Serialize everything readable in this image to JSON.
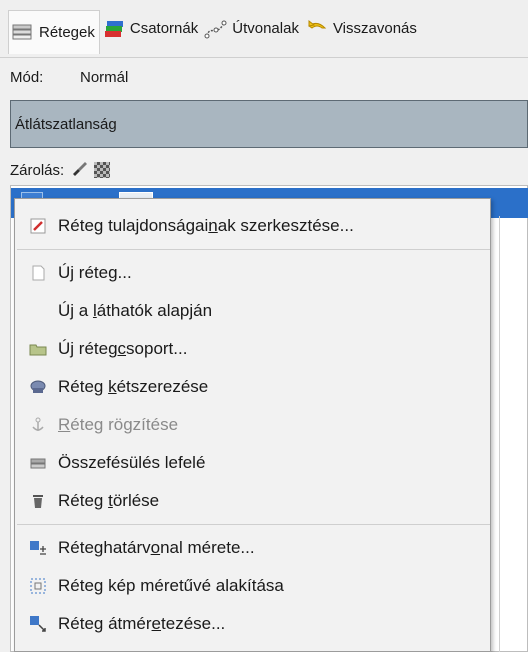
{
  "tabs": [
    {
      "label": "Rétegek",
      "icon": "layers-icon",
      "active": true
    },
    {
      "label": "Csatornák",
      "icon": "channels-icon",
      "active": false
    },
    {
      "label": "Útvonalak",
      "icon": "paths-icon",
      "active": false
    },
    {
      "label": "Visszavonás",
      "icon": "undo-history-icon",
      "active": false
    }
  ],
  "mode": {
    "label": "Mód:",
    "value": "Normál"
  },
  "opacity": {
    "label": "Átlátszatlanság"
  },
  "lock": {
    "label": "Zárolás:"
  },
  "menu": {
    "edit_attributes": {
      "before": "Réteg tulajdonságai",
      "key": "n",
      "after": "ak szerkesztése...",
      "icon": "edit-icon"
    },
    "new_layer": {
      "before": "Új réteg...",
      "icon": "new-layer-icon"
    },
    "new_from_visible": {
      "before": "Új a ",
      "key": "l",
      "after": "áthatók alapján"
    },
    "new_group": {
      "before": "Új réteg",
      "key": "c",
      "after": "soport...",
      "icon": "folder-icon"
    },
    "duplicate": {
      "before": "Réteg ",
      "key": "k",
      "after": "étszerezése",
      "icon": "duplicate-icon"
    },
    "anchor": {
      "before": "",
      "key": "R",
      "after": "éteg rögzítése",
      "icon": "anchor-icon"
    },
    "merge_down": {
      "before": "Összefésülés lefelé",
      "icon": "merge-down-icon"
    },
    "delete": {
      "before": "Réteg ",
      "key": "t",
      "after": "örlése",
      "icon": "trash-icon"
    },
    "boundary_size": {
      "before": "Réteghatárv",
      "key": "o",
      "after": "nal mérete...",
      "icon": "boundary-size-icon"
    },
    "layer_to_image_size": {
      "before": "Réteg kép méretűvé alakítása",
      "icon": "layer-to-image-size-icon"
    },
    "scale": {
      "before": "Réteg átmér",
      "key": "e",
      "after": "tezése...",
      "icon": "scale-layer-icon"
    }
  },
  "colors": {
    "opacity_bar": "#a9b6c0",
    "selected_row": "#2b70c9",
    "menu_bg": "#f2f2f2"
  }
}
